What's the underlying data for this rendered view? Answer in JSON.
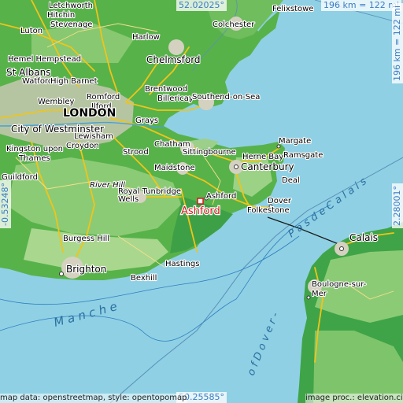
{
  "coords": {
    "top": "52.02025°",
    "bottom": "50.25585°",
    "left": "-0.53248°",
    "right": "2.28001°"
  },
  "scale": {
    "horizontal": "196 km = 122 mi",
    "vertical": "196 km = 122 mi"
  },
  "credits": {
    "left": "map data: openstreetmap, style: opentopomap",
    "right": "image proc.: elevation.city"
  },
  "places": {
    "letchworth": "Letchworth",
    "hitchin": "Hitchin",
    "stevenage": "Stevenage",
    "luton": "Luton",
    "harlow": "Harlow",
    "hemel": "Hemel Hempstead",
    "st_albans": "St Albans",
    "watford": "Watford",
    "high_barnet": "High Barnet",
    "chelmsford": "Chelmsford",
    "brentwood": "Brentwood",
    "billericay": "Billericay",
    "romford": "Romford",
    "ilford": "Ilford",
    "wembley": "Wembley",
    "london": "LONDON",
    "southend": "Southend-on-Sea",
    "westminster": "City of Westminster",
    "lewisham": "Lewisham",
    "grays": "Grays",
    "kingston": "Kingston upon",
    "thames": "Thames",
    "croydon": "Croydon",
    "chatham": "Chatham",
    "strood": "Strood",
    "sittingbourne": "Sittingbourne",
    "margate": "Margate",
    "herne_bay": "Herne Bay",
    "ramsgate": "Ramsgate",
    "maidstone": "Maidstone",
    "canterbury": "Canterbury",
    "river_hill": "River Hill",
    "royal_tunbridge": "Royal Tunbridge",
    "wells": "Wells",
    "ashford_small": "Ashford",
    "ashford": "Ashford",
    "deal": "Deal",
    "dover": "Dover",
    "folkestone": "Folkestone",
    "guildford": "Guildford",
    "burgess_hill": "Burgess Hill",
    "brighton": "Brighton",
    "hastings": "Hastings",
    "bexhill": "Bexhill",
    "colchester": "Colchester",
    "felixstowe": "Felixstowe",
    "calais": "Calais",
    "boulogne": "Boulogne-sur-",
    "mer": "Mer",
    "manche": "M a n c h e",
    "pas_de_calais": "P a s   d e   C a l a i s",
    "pas_de_dover": "o f   D o v e r  -"
  },
  "colors": {
    "sea": "#8fd0e4",
    "land_low": "#3aa84a",
    "land_mid": "#7cc26a",
    "urban": "#c9c9b4",
    "road": "#f0c419",
    "highlight": "#d11b1b"
  }
}
